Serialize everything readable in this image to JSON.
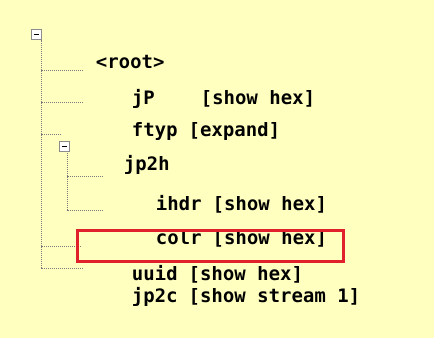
{
  "tree": {
    "root": {
      "label": "<root>"
    },
    "nodes": [
      {
        "name": "jP",
        "action": "[show hex]"
      },
      {
        "name": "ftyp",
        "action": "[expand]"
      },
      {
        "name": "jp2h",
        "action": ""
      },
      {
        "name": "ihdr",
        "action": "[show hex]"
      },
      {
        "name": "colr",
        "action": "[show hex]"
      },
      {
        "name": "uuid",
        "action": "[show hex]"
      },
      {
        "name": "jp2c",
        "action": "[show stream 1]"
      }
    ]
  },
  "colors": {
    "background": "#ffffc0",
    "highlight": "#e0202a",
    "connector": "#7a7a7a"
  }
}
